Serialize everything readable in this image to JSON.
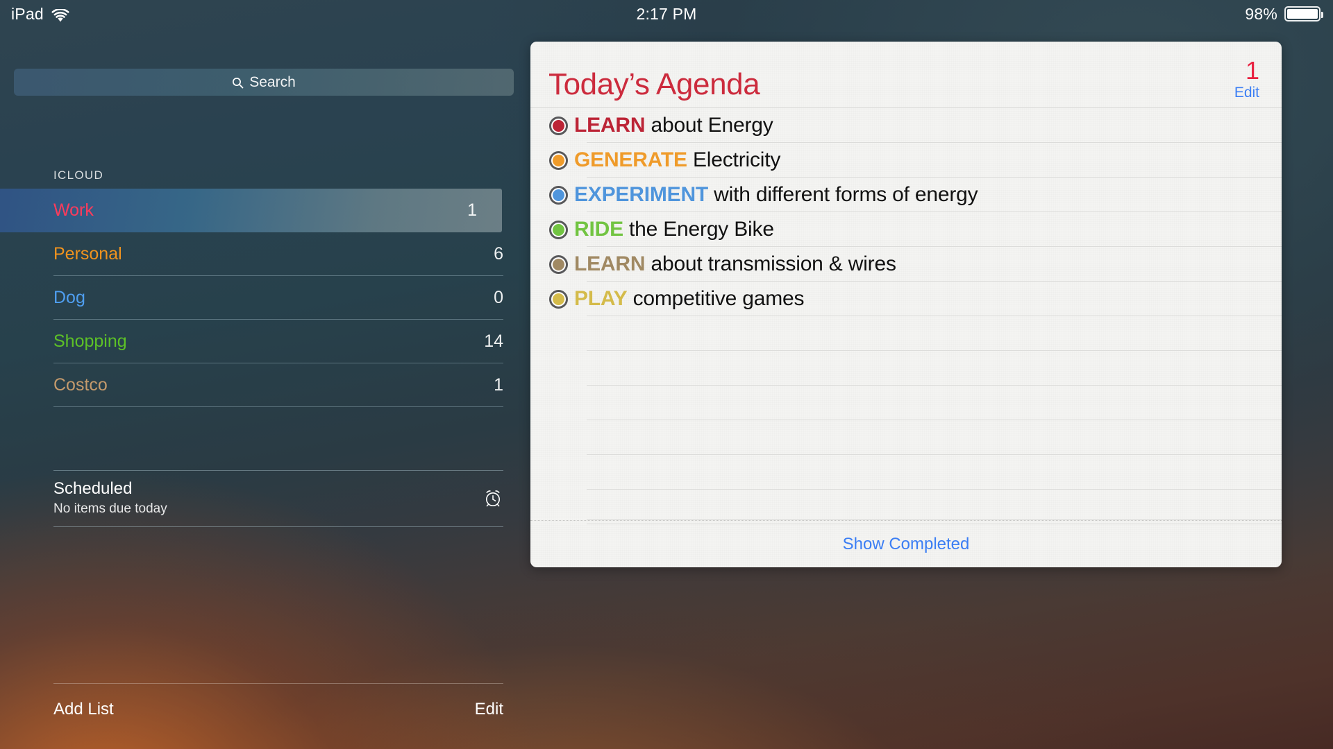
{
  "status_bar": {
    "device_label": "iPad",
    "wifi_icon": "wifi-icon",
    "time": "2:17 PM",
    "battery_percent": "98%",
    "battery_icon": "battery-icon"
  },
  "sidebar": {
    "search": {
      "placeholder": "Search",
      "value": "",
      "icon": "search-icon"
    },
    "group_header": "ICLOUD",
    "lists": [
      {
        "name": "Work",
        "count": "1",
        "color": "#ff3b5c",
        "selected": true
      },
      {
        "name": "Personal",
        "count": "6",
        "color": "#f0931e",
        "selected": false
      },
      {
        "name": "Dog",
        "count": "0",
        "color": "#4f9ef0",
        "selected": false
      },
      {
        "name": "Shopping",
        "count": "14",
        "color": "#5dc127",
        "selected": false
      },
      {
        "name": "Costco",
        "count": "1",
        "color": "#c49a6c",
        "selected": false
      }
    ],
    "scheduled": {
      "title": "Scheduled",
      "subtitle": "No items due today",
      "icon": "alarm-clock-icon"
    },
    "toolbar": {
      "add_list_label": "Add List",
      "edit_label": "Edit"
    }
  },
  "detail": {
    "title": "Today’s Agenda",
    "title_color": "#cc2b3d",
    "count": "1",
    "count_color": "#e8203f",
    "edit_label": "Edit",
    "link_color": "#3b7ef4",
    "reminders": [
      {
        "keyword": "LEARN",
        "rest": " about Energy",
        "color": "#bc2436",
        "bullet": "#bc2436"
      },
      {
        "keyword": "GENERATE",
        "rest": " Electricity",
        "color": "#ef9b2a",
        "bullet": "#ef9b2a"
      },
      {
        "keyword": "EXPERIMENT",
        "rest": " with different forms of energy",
        "color": "#4f95dc",
        "bullet": "#4f95dc"
      },
      {
        "keyword": "RIDE",
        "rest": " the Energy Bike",
        "color": "#72c442",
        "bullet": "#72c442"
      },
      {
        "keyword": "LEARN",
        "rest": " about transmission & wires",
        "color": "#a08963",
        "bullet": "#a08963"
      },
      {
        "keyword": "PLAY",
        "rest": " competitive games",
        "color": "#d4bb4a",
        "bullet": "#d4bb4a"
      }
    ],
    "empty_line_count": 6,
    "footer": {
      "show_completed_label": "Show Completed"
    }
  }
}
